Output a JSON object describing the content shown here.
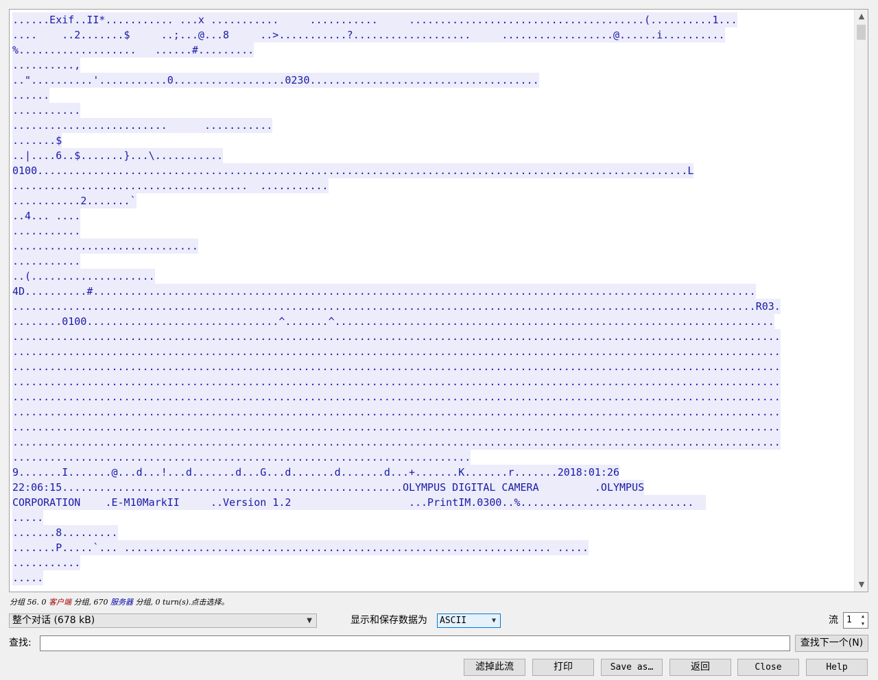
{
  "stream": {
    "lines": [
      "......Exif..II*........... ...x ...........     ...........     ......................................(..........1...",
      "....    ..2.......$     ..;...@...8     ..>...........?...................     ..................@......i..........",
      "%...................   ......#.........",
      "..........,",
      "..\"..........'...........0..................0230.....................................",
      "......",
      "...........",
      ".........................      ...........",
      ".......$",
      "..|....6..$.......}...\\...........",
      "0100.........................................................................................................L",
      "......................................  ...........",
      "...........2.......`",
      "..4... ....",
      "...........",
      "..............................",
      "...........",
      "..(....................",
      "4D..........#...........................................................................................................",
      "........................................................................................................................R03.",
      "........0100...............................^.......^.......................................................................",
      "............................................................................................................................",
      "............................................................................................................................",
      "............................................................................................................................",
      "............................................................................................................................",
      "............................................................................................................................",
      "............................................................................................................................",
      "............................................................................................................................",
      "............................................................................................................................",
      "..........................................................................",
      "9.......I.......@...d...!...d.......d...G...d.......d.......d...+.......K.......r.......2018:01:26",
      "22:06:15.......................................................OLYMPUS DIGITAL CAMERA         .OLYMPUS",
      "CORPORATION    .E-M10MarkII     ..Version 1.2                   ...PrintIM.0300..%............................  ",
      ".....",
      ".......8.........",
      ".......P.....`... ..................................................................... .....",
      "...........",
      "....."
    ]
  },
  "status": {
    "prefix": "分组 56. 0 ",
    "client": "客户端",
    "mid": " 分组, 670 ",
    "server": "服务器",
    "suffix": " 分组, 0 turn(s).点击选择。"
  },
  "conversation_select": {
    "value": "整个对话 (678 kB)"
  },
  "format": {
    "label": "显示和保存数据为",
    "value": "ASCII"
  },
  "stream_index": {
    "label": "流",
    "value": "1"
  },
  "find": {
    "label": "查找:",
    "value": "",
    "next_label": "查找下一个(N)"
  },
  "buttons": {
    "filter": "滤掉此流",
    "print": "打印",
    "save_as": "Save as…",
    "back": "返回",
    "close": "Close",
    "help": "Help"
  },
  "colors": {
    "client_text": "#1a1aa6",
    "client_bg": "#ececfb",
    "status_client": "#a00000",
    "status_server": "#0000a6"
  },
  "icons": {
    "scroll_up": "chevron-up-icon",
    "scroll_down": "chevron-down-icon",
    "dropdown": "chevron-down-icon",
    "spinner": "up-down-arrows-icon"
  }
}
